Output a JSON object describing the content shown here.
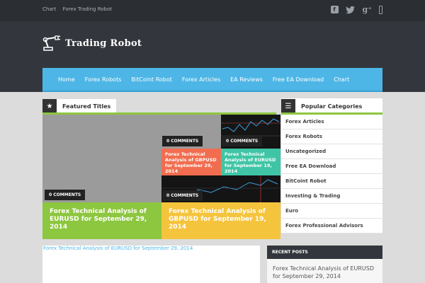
{
  "topbar": {
    "links": [
      "Chart",
      "Forex Trading Robot"
    ],
    "icons": [
      "facebook-icon",
      "twitter-icon",
      "google-plus-icon",
      "mobile-icon"
    ]
  },
  "logo": {
    "text": "Trading Robot"
  },
  "nav": {
    "items": [
      "Home",
      "Forex Robots",
      "BitCoint Robot",
      "Forex Articles",
      "EA Reviews",
      "Free EA Download",
      "Chart"
    ]
  },
  "featured": {
    "heading": "Featured Titles",
    "tiles": [
      {
        "badge": "0 COMMENTS",
        "title": "Forex Technical Analysis of EURUSD for September 29, 2014",
        "color": "#8dc63f"
      },
      {
        "badge": "0 COMMENTS",
        "title": "Forex Technical Analysis of GBPUSD for September 29, 2014",
        "color": "#f26d4f"
      },
      {
        "badge": "0 COMMENTS",
        "title": "Forex Technical Analysis of EURUSD for September 19, 2014",
        "color": "#3fc5a6"
      },
      {
        "badge": "0 COMMENTS",
        "title": "Forex Technical Analysis of GBPUSD for September 19, 2014",
        "color": "#f5c43d"
      }
    ]
  },
  "categories": {
    "heading": "Popular Categories",
    "items": [
      "Forex Articles",
      "Forex Robots",
      "Uncategorized",
      "Free EA Download",
      "BitCoint Robot",
      "Investing & Trading",
      "Euro",
      "Forex Professional Advisors"
    ]
  },
  "bottom": {
    "link": "Forex Technical Analysis of EURUSD for September 29, 2014"
  },
  "recent": {
    "heading": "RECENT POSTS",
    "first": "Forex Technical Analysis of EURUSD for September 29, 2014"
  }
}
